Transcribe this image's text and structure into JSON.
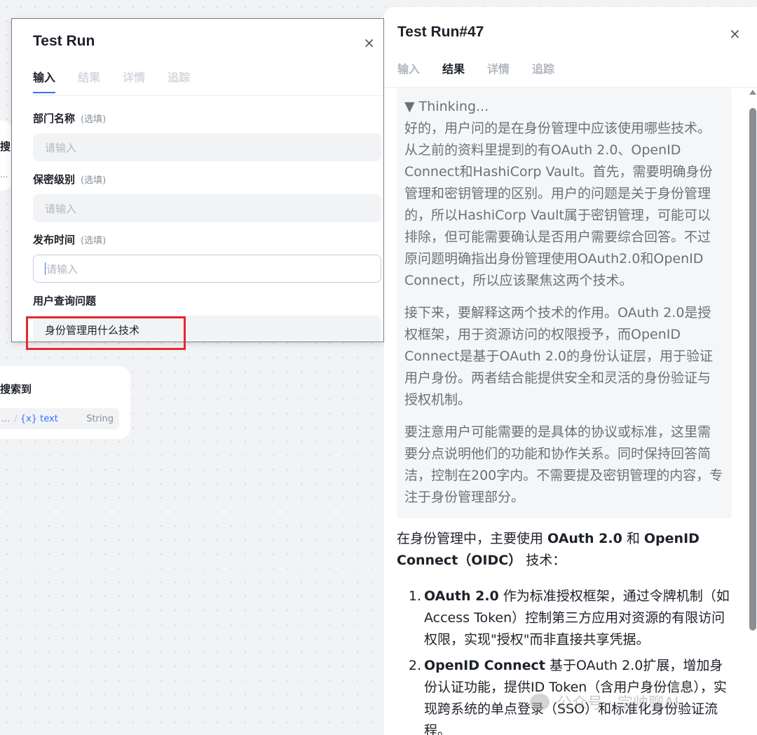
{
  "canvas": {
    "top_node": {
      "title": "搜",
      "sub": "..."
    },
    "search_node": {
      "title": "搜索到",
      "var_ellipsis": "...",
      "var_slash": "/",
      "var_name": "{x} text",
      "var_type": "String"
    }
  },
  "dialog": {
    "title": "Test Run",
    "close": "×",
    "tabs": [
      {
        "label": "输入",
        "active": true
      },
      {
        "label": "结果",
        "active": false
      },
      {
        "label": "详情",
        "active": false
      },
      {
        "label": "追踪",
        "active": false
      }
    ],
    "fields": [
      {
        "label": "部门名称",
        "optional": "(选填)",
        "placeholder": "请输入",
        "value": ""
      },
      {
        "label": "保密级别",
        "optional": "(选填)",
        "placeholder": "请输入",
        "value": ""
      },
      {
        "label": "发布时间",
        "optional": "(选填)",
        "placeholder": "请输入",
        "value": ""
      },
      {
        "label": "用户查询问题",
        "optional": "",
        "placeholder": "",
        "value": "身份管理用什么技术"
      }
    ]
  },
  "panel": {
    "title": "Test Run#47",
    "close": "×",
    "tabs": [
      {
        "label": "输入",
        "active": false
      },
      {
        "label": "结果",
        "active": true
      },
      {
        "label": "详情",
        "active": false
      },
      {
        "label": "追踪",
        "active": false
      }
    ],
    "thinking": {
      "header": "▼ Thinking...",
      "paragraphs": [
        "好的，用户问的是在身份管理中应该使用哪些技术。从之前的资料里提到的有OAuth 2.0、OpenID Connect和HashiCorp Vault。首先，需要明确身份管理和密钥管理的区别。用户的问题是关于身份管理的，所以HashiCorp Vault属于密钥管理，可能可以排除，但可能需要确认是否用户需要综合回答。不过原问题明确指出身份管理使用OAuth2.0和OpenID Connect，所以应该聚焦这两个技术。",
        "接下来，要解释这两个技术的作用。OAuth 2.0是授权框架，用于资源访问的权限授予，而OpenID Connect是基于OAuth 2.0的身份认证层，用于验证用户身份。两者结合能提供安全和灵活的身份验证与授权机制。",
        "要注意用户可能需要的是具体的协议或标准，这里需要分点说明他们的功能和协作关系。同时保持回答简洁，控制在200字内。不需要提及密钥管理的内容，专注于身份管理部分。"
      ]
    },
    "answer": {
      "intro_pre": "在身份管理中，主要使用 ",
      "intro_b1": "OAuth 2.0",
      "intro_mid": " 和 ",
      "intro_b2": "OpenID Connect（OIDC）",
      "intro_post": " 技术：",
      "items": [
        {
          "num": "1.",
          "bold": "OAuth 2.0",
          "text": " 作为标准授权框架，通过令牌机制（如Access Token）控制第三方应用对资源的有限访问权限，实现\"授权\"而非直接共享凭据。"
        },
        {
          "num": "2.",
          "bold": "OpenID Connect",
          "text": " 基于OAuth 2.0扩展，增加身份认证功能，提供ID Token（含用户身份信息），实现跨系统的单点登录（SSO）和标准化身份验证流程。"
        }
      ]
    }
  },
  "watermark": {
    "text": "公众号 · 宗帅聊AI"
  },
  "colors": {
    "accent": "#3370ff",
    "highlight": "#e5282d"
  }
}
